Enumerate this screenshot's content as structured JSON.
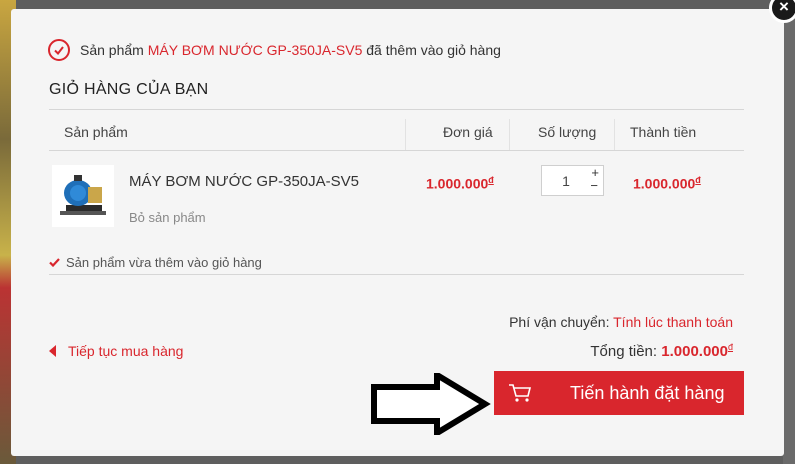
{
  "notice": {
    "prefix": "Sản phẩm",
    "product": "MÁY BƠM NƯỚC GP-350JA-SV5",
    "suffix": "đã thêm vào giỏ hàng"
  },
  "cart_title": "GIỎ HÀNG CỦA BẠN",
  "columns": {
    "product": "Sản phẩm",
    "unit_price": "Đơn giá",
    "quantity": "Số lượng",
    "subtotal": "Thành tiền"
  },
  "item": {
    "name": "MÁY BƠM NƯỚC GP-350JA-SV5",
    "remove": "Bỏ sản phẩm",
    "unit_price": "1.000.000",
    "quantity": "1",
    "subtotal": "1.000.000",
    "currency": "đ"
  },
  "added_note": "Sản phẩm vừa thêm vào giỏ hàng",
  "shipping": {
    "label": "Phí vận chuyển:",
    "value": "Tính lúc thanh toán"
  },
  "total": {
    "label": "Tổng tiền:",
    "value": "1.000.000",
    "currency": "đ"
  },
  "continue_label": "Tiếp tục mua hàng",
  "checkout_label": "Tiến hành đặt hàng",
  "close_symbol": "×",
  "qty_plus": "+",
  "qty_minus": "−",
  "colors": {
    "accent": "#d9262d",
    "overlay": "#5e5e5e",
    "modal_bg": "#f5f5f5"
  }
}
